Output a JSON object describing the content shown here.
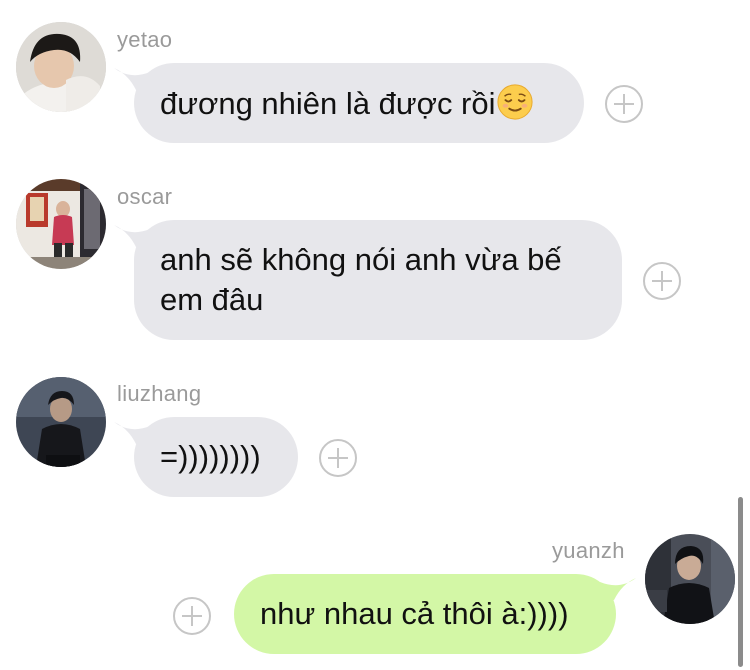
{
  "messages": [
    {
      "sender": "yetao",
      "text": "đương nhiên là được rồi",
      "emoji": "relieved-face-emoji"
    },
    {
      "sender": "oscar",
      "line1": "anh sẽ không nói anh vừa bế",
      "line2": "em đâu"
    },
    {
      "sender": "liuzhang",
      "text": "=))))))))"
    },
    {
      "sender": "yuanzh",
      "text": "như nhau cả thôi à:))))"
    }
  ],
  "colors": {
    "incoming_bubble": "#e7e7eb",
    "outgoing_bubble": "#d3f7a6",
    "sender_name": "#9a9a9a",
    "add_button": "#c6c6c6"
  }
}
